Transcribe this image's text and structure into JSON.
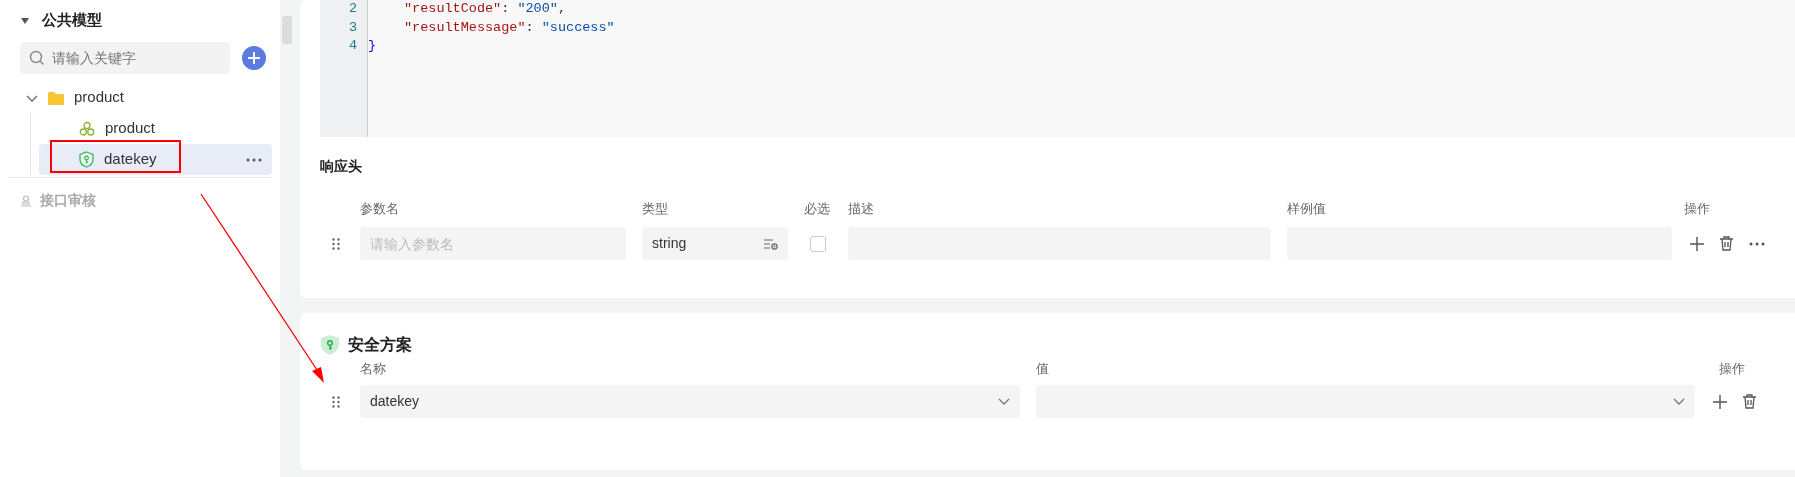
{
  "sidebar": {
    "section_title": "公共模型",
    "expanded": true,
    "search": {
      "placeholder": "请输入关键字"
    },
    "tree": [
      {
        "label": "product",
        "kind": "folder",
        "expanded": true,
        "selected": false,
        "children": [
          {
            "label": "product",
            "kind": "model",
            "selected": false
          },
          {
            "label": "datekey",
            "kind": "security",
            "selected": true
          }
        ]
      }
    ],
    "footer_items": [
      {
        "label": "接口审核",
        "disabled": true
      }
    ]
  },
  "code_editor": {
    "lines": [
      {
        "number": "2",
        "indented": true,
        "tokens": [
          {
            "kind": "key",
            "text": "\"resultCode\""
          },
          {
            "kind": "punct",
            "text": ": "
          },
          {
            "kind": "string",
            "text": "\"200\""
          },
          {
            "kind": "punct",
            "text": ","
          }
        ]
      },
      {
        "number": "3",
        "indented": true,
        "tokens": [
          {
            "kind": "key",
            "text": "\"resultMessage\""
          },
          {
            "kind": "punct",
            "text": ": "
          },
          {
            "kind": "string",
            "text": "\"success\""
          }
        ]
      },
      {
        "number": "4",
        "indented": false,
        "tokens": [
          {
            "kind": "brace",
            "text": "}"
          }
        ]
      }
    ]
  },
  "response_headers": {
    "title": "响应头",
    "columns": [
      "参数名",
      "类型",
      "必选",
      "描述",
      "样例值",
      "操作"
    ],
    "rows": [
      {
        "name_placeholder": "请输入参数名",
        "type": "string",
        "required": false
      }
    ]
  },
  "security_scheme": {
    "title": "安全方案",
    "columns": [
      "名称",
      "值",
      "操作"
    ],
    "rows": [
      {
        "name": "datekey"
      }
    ]
  },
  "annotations": [
    {
      "kind": "box"
    },
    {
      "kind": "arrow"
    }
  ]
}
